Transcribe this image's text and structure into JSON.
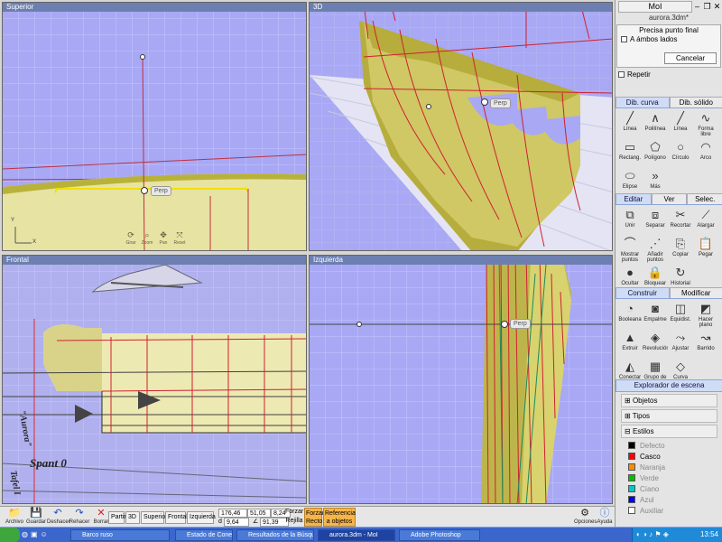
{
  "viewports": {
    "top": {
      "title": "Superior",
      "snap": "Perp",
      "axis_y": "Y",
      "axis_x": "X",
      "nav": [
        "Girar",
        "Zoom",
        "Pan",
        "Reset"
      ]
    },
    "persp": {
      "title": "3D",
      "snap": "Perp"
    },
    "front": {
      "title": "Frontal",
      "drawing": [
        "\"Aurora\"",
        "Spant 0",
        "Tafel I"
      ]
    },
    "left": {
      "title": "Izquierda",
      "snap": "Perp"
    }
  },
  "panel": {
    "window_title": "MoI",
    "file_name": "aurora.3dm*",
    "prompt": "Precisa punto final",
    "both_sides_label": "A ámbos lados",
    "cancel_label": "Cancelar",
    "repeat_label": "Repetir",
    "draw_tabs": [
      "Dib. curva",
      "Dib. sólido"
    ],
    "draw_tools": [
      {
        "label": "Línea",
        "icon": "╱"
      },
      {
        "label": "Polilínea",
        "icon": "∧"
      },
      {
        "label": "Línea",
        "icon": "╱"
      },
      {
        "label": "Forma libre",
        "icon": "∿"
      },
      {
        "label": "Rectang.",
        "icon": "▭"
      },
      {
        "label": "Polígono",
        "icon": "⬠"
      },
      {
        "label": "Círculo",
        "icon": "○"
      },
      {
        "label": "Arco",
        "icon": "◠"
      },
      {
        "label": "Elipse",
        "icon": "⬭"
      },
      {
        "label": "Más",
        "icon": "»"
      }
    ],
    "edit_tabs": [
      "Editar",
      "Ver",
      "Selec."
    ],
    "edit_tools": [
      {
        "label": "Unir",
        "icon": "⧉"
      },
      {
        "label": "Separar",
        "icon": "⧈"
      },
      {
        "label": "Recortar",
        "icon": "✂"
      },
      {
        "label": "Alargar",
        "icon": "⟋"
      },
      {
        "label": "Mostrar puntos",
        "icon": "⌒"
      },
      {
        "label": "Añadir puntos",
        "icon": "⋰"
      },
      {
        "label": "Copiar",
        "icon": "⎘"
      },
      {
        "label": "Pegar",
        "icon": "📋"
      },
      {
        "label": "Ocultar",
        "icon": "●"
      },
      {
        "label": "Bloquear",
        "icon": "🔒"
      },
      {
        "label": "Historial",
        "icon": "↻"
      }
    ],
    "build_tabs": [
      "Construir",
      "Modificar"
    ],
    "build_tools": [
      {
        "label": "Booleana",
        "icon": "◔"
      },
      {
        "label": "Empalme",
        "icon": "◙"
      },
      {
        "label": "Equidist.",
        "icon": "◫"
      },
      {
        "label": "Hacer plano",
        "icon": "◩"
      },
      {
        "label": "Extruir",
        "icon": "▲"
      },
      {
        "label": "Revolución",
        "icon": "◈"
      },
      {
        "label": "Ajustar",
        "icon": "⤳"
      },
      {
        "label": "Barrido",
        "icon": "↝"
      },
      {
        "label": "Conectar",
        "icon": "◭"
      },
      {
        "label": "Grupo de curvas",
        "icon": "▦"
      },
      {
        "label": "Curva",
        "icon": "◇"
      }
    ],
    "explorer": {
      "title": "Explorador de escena",
      "nodes": [
        "Objetos",
        "Tipos",
        "Estilos"
      ],
      "styles": [
        {
          "name": "Defecto",
          "color": "#000000"
        },
        {
          "name": "Casco",
          "color": "#ff0000"
        },
        {
          "name": "Naranja",
          "color": "#ff8c00"
        },
        {
          "name": "Verde",
          "color": "#00c000"
        },
        {
          "name": "Cíano",
          "color": "#00c8c8"
        },
        {
          "name": "Azul",
          "color": "#0000ff"
        },
        {
          "name": "Auxiliar",
          "color": "#ffffff"
        }
      ]
    }
  },
  "bottom": {
    "file_buttons": [
      {
        "label": "Archivo",
        "icon": "📁"
      },
      {
        "label": "Guardar",
        "icon": "💾"
      },
      {
        "label": "Deshacer",
        "icon": "↶"
      },
      {
        "label": "Rehacer",
        "icon": "↷"
      },
      {
        "label": "Borrar",
        "icon": "✕"
      }
    ],
    "view_buttons": [
      "Partir",
      "3D",
      "Superior",
      "Frontal",
      "Izquierda"
    ],
    "coords": {
      "x": "176,46",
      "y": "51,05",
      "z": "8,24",
      "d_label": "d",
      "d": "9,64",
      "angle_label": "∠",
      "angle": "91,39"
    },
    "force_label": "Forzar",
    "grid_label": "Rejilla",
    "force_straight": "Forzar Recto",
    "object_ref": "Referencia a objetos",
    "options": "Opciones",
    "help": "Ayuda"
  },
  "taskbar": {
    "items": [
      "Barco ruso",
      "Estado de Conexiones ...",
      "Resultados de la Búsqu...",
      "aurora.3dm - MoI",
      "Adobe Photoshop"
    ],
    "clock": "13:54"
  }
}
